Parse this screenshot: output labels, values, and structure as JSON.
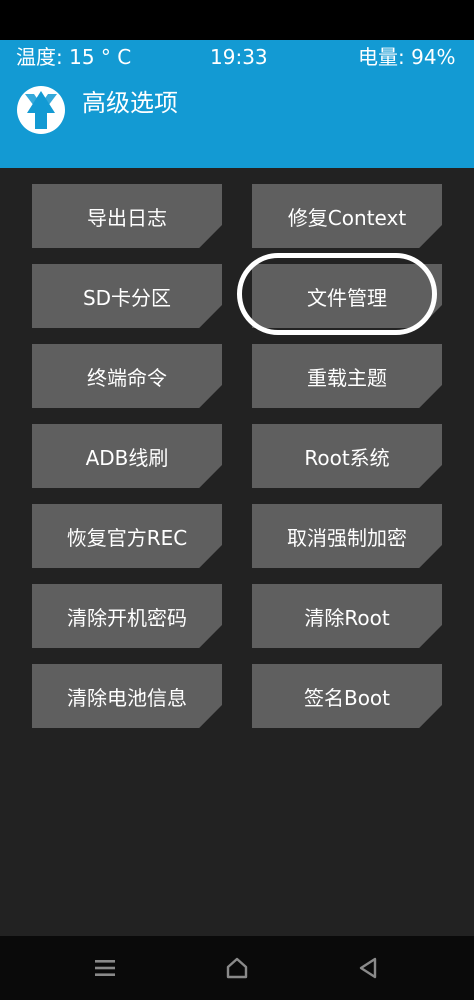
{
  "status_bar": {
    "temperature": "温度: 15 ° C",
    "time": "19:33",
    "battery": "电量: 94%"
  },
  "header": {
    "logo_icon": "twrp-logo-icon",
    "title": "高级选项"
  },
  "buttons": {
    "export_log": "导出日志",
    "fix_context": "修复Context",
    "sd_partition": "SD卡分区",
    "file_manager": "文件管理",
    "terminal": "终端命令",
    "reload_theme": "重载主题",
    "adb_sideload": "ADB线刷",
    "root_system": "Root系统",
    "restore_stock_rec": "恢复官方REC",
    "disable_force_encrypt": "取消强制加密",
    "clear_lock_password": "清除开机密码",
    "clear_root": "清除Root",
    "clear_battery_info": "清除电池信息",
    "sign_boot": "签名Boot"
  },
  "highlighted_item": "文件管理",
  "nav_bar": {
    "menu_icon": "menu-icon",
    "home_icon": "home-icon",
    "back_icon": "back-icon"
  },
  "colors": {
    "header_bg": "#139ad3",
    "page_bg": "#222222",
    "button_bg": "#5f5f5f",
    "text": "#ffffff"
  }
}
